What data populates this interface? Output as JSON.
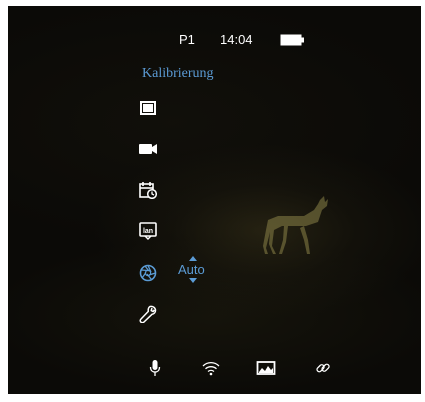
{
  "status": {
    "profile": "P1",
    "time": "14:04",
    "battery_icon": "battery-icon"
  },
  "menu": {
    "title": "Kalibrierung",
    "items": [
      {
        "icon": "display-icon"
      },
      {
        "icon": "camera-icon"
      },
      {
        "icon": "calendar-clock-icon"
      },
      {
        "icon": "lan-icon"
      },
      {
        "icon": "aperture-icon",
        "value": "Auto"
      },
      {
        "icon": "wrench-icon"
      }
    ]
  },
  "bottom_bar": {
    "icons": [
      "microphone-icon",
      "wifi-icon",
      "rangefinder-icon",
      "link-icon"
    ]
  },
  "colors": {
    "accent": "#5b9bd5",
    "background": "#0b0a07",
    "icon": "#ffffff"
  }
}
